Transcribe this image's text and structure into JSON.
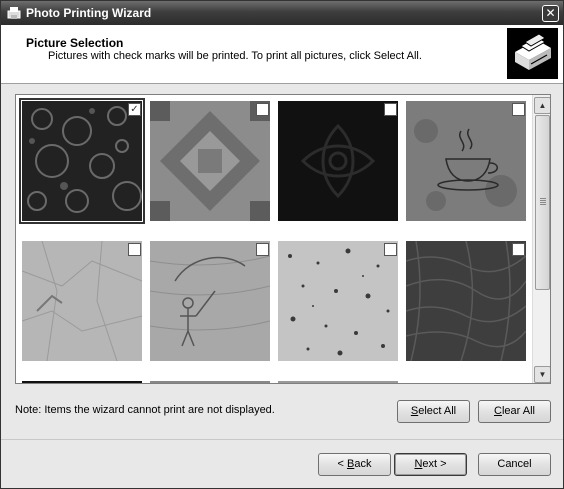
{
  "window": {
    "title": "Photo Printing Wizard",
    "close_glyph": "✕"
  },
  "header": {
    "title": "Picture Selection",
    "subtitle": "Pictures with check marks will be printed.  To print all pictures, click Select All."
  },
  "pictures": [
    {
      "pattern": "circles-emboss",
      "checked": true
    },
    {
      "pattern": "quilt-diamond",
      "checked": false
    },
    {
      "pattern": "dark-ornament",
      "checked": false
    },
    {
      "pattern": "coffee-cup",
      "checked": false
    },
    {
      "pattern": "crumpled-paper",
      "checked": false
    },
    {
      "pattern": "fishing-sketch",
      "checked": false
    },
    {
      "pattern": "speckled-stone",
      "checked": false
    },
    {
      "pattern": "dark-grass",
      "checked": false
    }
  ],
  "checkmark": "✓",
  "scrollbar": {
    "up": "▲",
    "down": "▼"
  },
  "note": "Note: Items the wizard cannot print are not displayed.",
  "buttons": {
    "select_all": {
      "mnemonic": "S",
      "rest": "elect All"
    },
    "clear_all": {
      "mnemonic": "C",
      "rest": "lear All"
    },
    "back": {
      "prefix": "< ",
      "mnemonic": "B",
      "rest": "ack"
    },
    "next": {
      "mnemonic": "N",
      "rest": "ext >"
    },
    "cancel": {
      "label": "Cancel"
    }
  },
  "colors": {
    "titlebar": "#2c2c2c",
    "window_bg": "#e8e8e8",
    "selection_outline": "#333333"
  }
}
